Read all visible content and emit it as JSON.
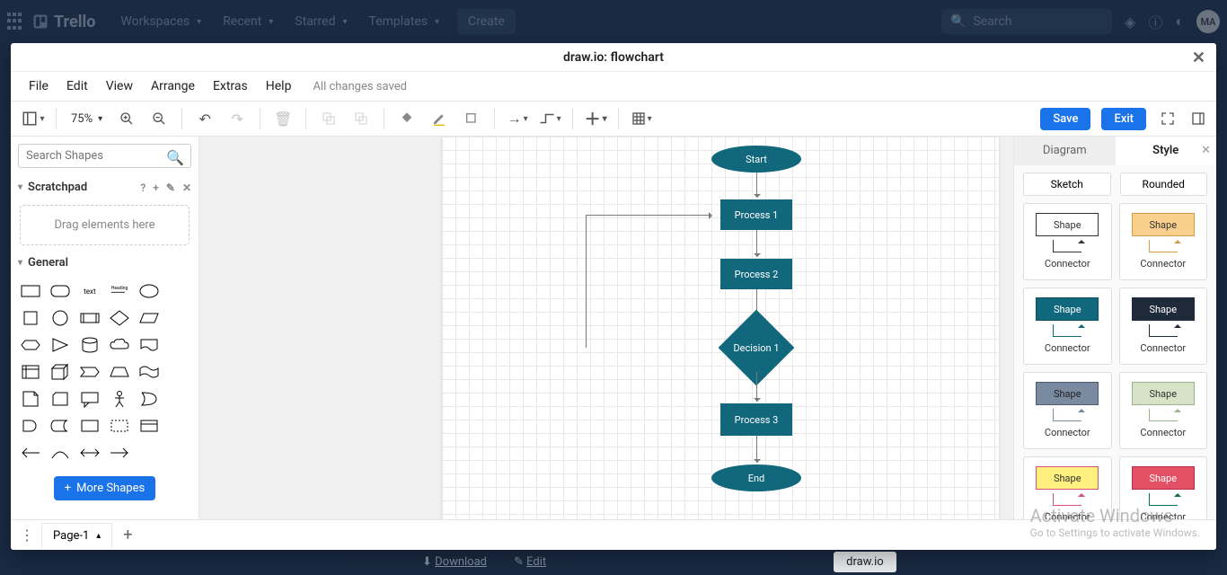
{
  "trello": {
    "logo": "Trello",
    "nav": [
      "Workspaces",
      "Recent",
      "Starred",
      "Templates"
    ],
    "create": "Create",
    "searchPlaceholder": "Search",
    "avatar": "MA"
  },
  "modal": {
    "title": "draw.io: flowchart",
    "menus": [
      "File",
      "Edit",
      "View",
      "Arrange",
      "Extras",
      "Help"
    ],
    "saveStatus": "All changes saved",
    "zoom": "75%",
    "saveBtn": "Save",
    "exitBtn": "Exit"
  },
  "shapesPanel": {
    "searchPlaceholder": "Search Shapes",
    "scratchpad": "Scratchpad",
    "dropHint": "Drag elements here",
    "general": "General",
    "moreShapes": "More Shapes"
  },
  "flowchart": {
    "start": "Start",
    "p1": "Process 1",
    "p2": "Process 2",
    "d1": "Decision 1",
    "p3": "Process 3",
    "end": "End"
  },
  "rightPanel": {
    "tabDiagram": "Diagram",
    "tabStyle": "Style",
    "sketch": "Sketch",
    "rounded": "Rounded",
    "shapeLabel": "Shape",
    "connLabel": "Connector",
    "swatches": [
      {
        "shapeBg": "#ffffff",
        "shapeFg": "#333333",
        "shapeBorder": "#333333",
        "conn": "#333333"
      },
      {
        "shapeBg": "#f8cf8d",
        "shapeFg": "#333333",
        "shapeBorder": "#d89b4a",
        "conn": "#d89b4a"
      },
      {
        "shapeBg": "#11677c",
        "shapeFg": "#ffffff",
        "shapeBorder": "#0b4f5f",
        "conn": "#11677c"
      },
      {
        "shapeBg": "#1f2b3a",
        "shapeFg": "#ffffff",
        "shapeBorder": "#1f2b3a",
        "conn": "#1f2b3a"
      },
      {
        "shapeBg": "#7a8aa0",
        "shapeFg": "#222222",
        "shapeBorder": "#4a5a72",
        "conn": "#7a8aa0"
      },
      {
        "shapeBg": "#d6e3c6",
        "shapeFg": "#333333",
        "shapeBorder": "#9bb389",
        "conn": "#9bb389"
      },
      {
        "shapeBg": "#fff080",
        "shapeFg": "#333333",
        "shapeBorder": "#d8507a",
        "conn": "#d8507a"
      },
      {
        "shapeBg": "#e15065",
        "shapeFg": "#ffffff",
        "shapeBorder": "#b52e44",
        "conn": "#0c6b5a"
      }
    ]
  },
  "pageTabs": {
    "page1": "Page-1"
  },
  "bgStrip": {
    "download": "Download",
    "edit": "Edit",
    "drawio": "draw.io"
  },
  "watermark": {
    "l1": "Activate Windows",
    "l2": "Go to Settings to activate Windows."
  }
}
